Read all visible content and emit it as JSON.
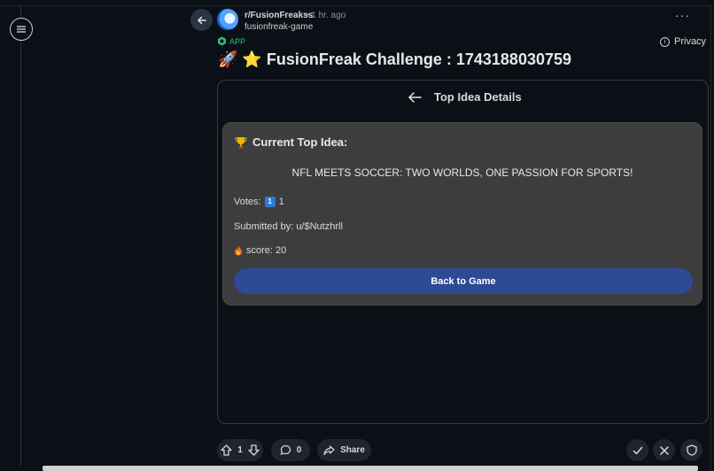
{
  "post": {
    "subreddit": "r/FusionFreakss",
    "time": "• 1 hr. ago",
    "user": "fusionfreak-game",
    "app_badge": "APP",
    "privacy": "Privacy",
    "title": "🚀 ⭐ FusionFreak Challenge : 1743188030759"
  },
  "app": {
    "header": "Top Idea Details",
    "card_title": "Current Top Idea:",
    "idea_text": "NFL MEETS SOCCER: TWO WORLDS, ONE PASSION FOR SPORTS!",
    "votes_label": "Votes:",
    "votes_key": "1",
    "votes_value": "1",
    "submitted": "Submitted by: u/$Nutzhrll",
    "score": "score: 20",
    "back_button": "Back to Game"
  },
  "footer": {
    "upvotes": "1",
    "comments": "0",
    "share": "Share"
  },
  "colors": {
    "background": "#0b1017",
    "card": "#3d3d3d",
    "button": "#2e4a94",
    "app_green": "#2fbf71"
  }
}
